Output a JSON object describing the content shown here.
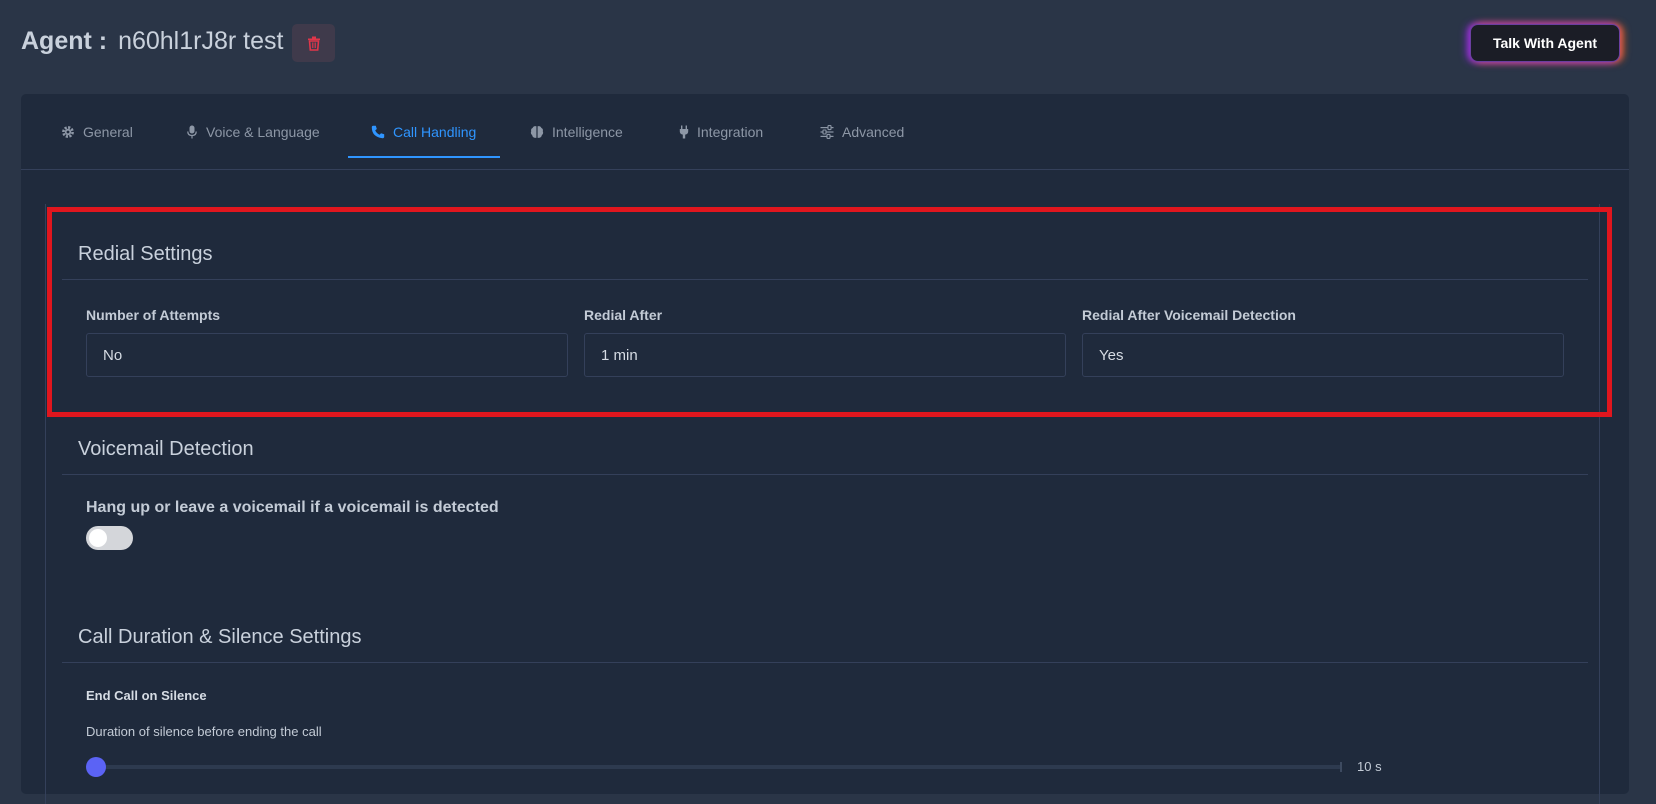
{
  "header": {
    "agent_prefix": "Agent :",
    "agent_name": "n60hl1rJ8r test",
    "talk_button_label": "Talk With Agent",
    "delete_icon": "trash-icon"
  },
  "tabs": [
    {
      "label": "General",
      "icon": "gear-icon",
      "active": false
    },
    {
      "label": "Voice & Language",
      "icon": "microphone-icon",
      "active": false
    },
    {
      "label": "Call Handling",
      "icon": "phone-icon",
      "active": true
    },
    {
      "label": "Intelligence",
      "icon": "brain-icon",
      "active": false
    },
    {
      "label": "Integration",
      "icon": "plug-icon",
      "active": false
    },
    {
      "label": "Advanced",
      "icon": "sliders-icon",
      "active": false
    }
  ],
  "redial": {
    "title": "Redial Settings",
    "fields": [
      {
        "label": "Number of Attempts",
        "value": "No"
      },
      {
        "label": "Redial After",
        "value": "1 min"
      },
      {
        "label": "Redial After Voicemail Detection",
        "value": "Yes"
      }
    ]
  },
  "voicemail": {
    "title": "Voicemail Detection",
    "toggle_label": "Hang up or leave a voicemail if a voicemail is detected",
    "toggle_on": false
  },
  "call_duration": {
    "title": "Call Duration & Silence Settings",
    "end_call_label": "End Call on Silence",
    "silence_description": "Duration of silence before ending the call",
    "silence_value_text": "10 s",
    "silence_slider_fraction": 0
  },
  "colors": {
    "background": "#2a3547",
    "card": "#1f2a3c",
    "accent": "#2f95ff",
    "highlight": "#e0161e",
    "slider_thumb": "#5b63f5",
    "delete_icon": "#e0364a"
  }
}
